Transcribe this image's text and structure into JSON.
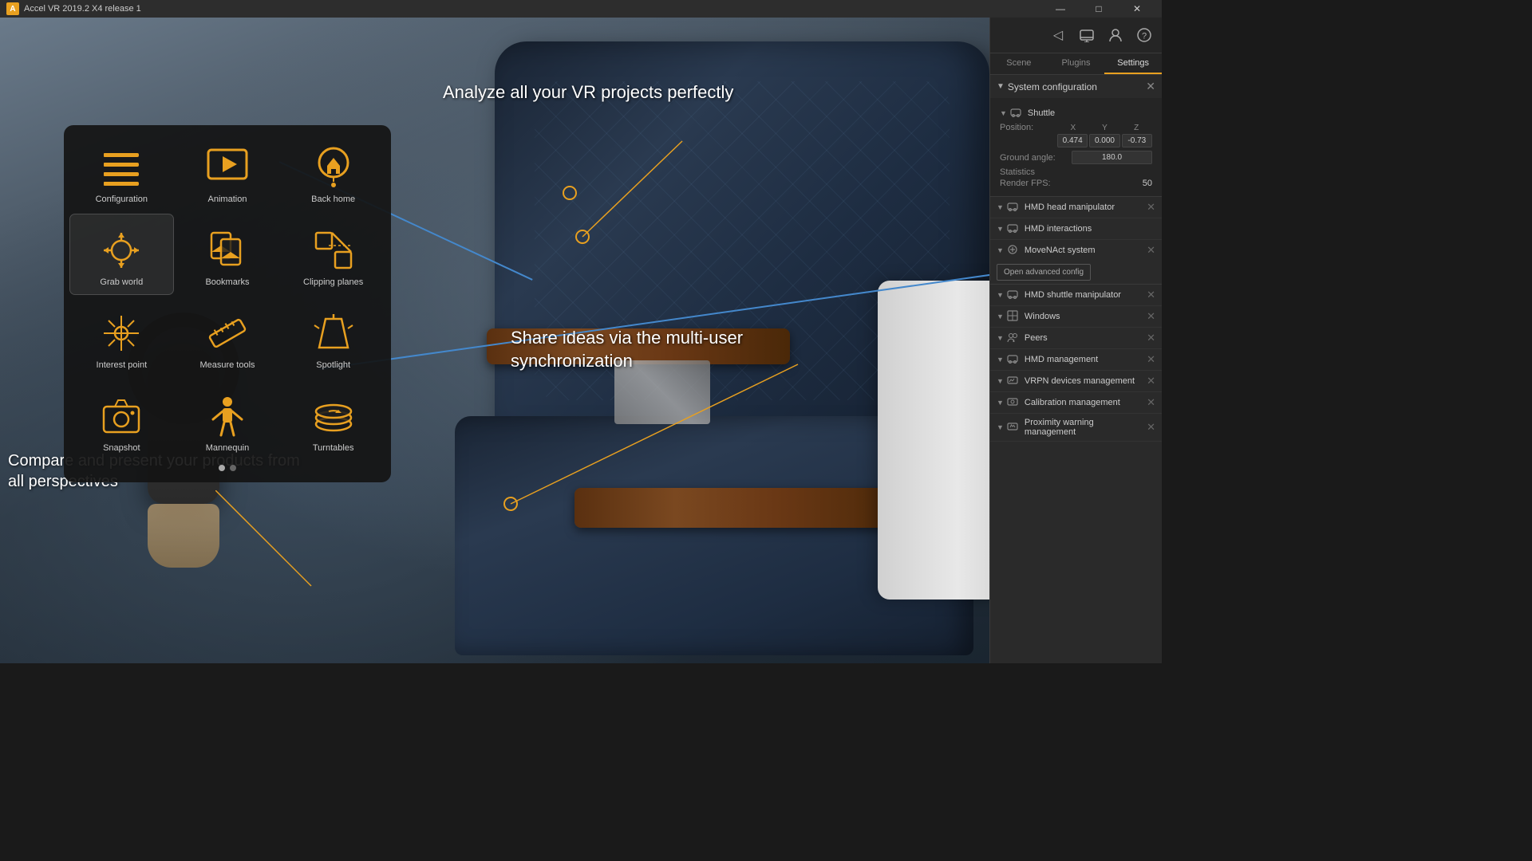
{
  "titlebar": {
    "title": "Accel VR 2019.2 X4 release 1",
    "icon": "A",
    "controls": {
      "minimize": "—",
      "maximize": "□",
      "close": "✕"
    }
  },
  "toolbar": {
    "icons": [
      "rss",
      "monitor",
      "user",
      "help"
    ]
  },
  "vr_menu": {
    "items": [
      {
        "id": "configuration",
        "label": "Configuration",
        "icon": "list"
      },
      {
        "id": "animation",
        "label": "Animation",
        "icon": "film"
      },
      {
        "id": "back_home",
        "label": "Back home",
        "icon": "home"
      },
      {
        "id": "grab_world",
        "label": "Grab world",
        "icon": "arrows"
      },
      {
        "id": "bookmarks",
        "label": "Bookmarks",
        "icon": "bookmark"
      },
      {
        "id": "clipping_planes",
        "label": "Clipping planes",
        "icon": "scissors"
      },
      {
        "id": "interest_point",
        "label": "Interest point",
        "icon": "star"
      },
      {
        "id": "measure_tools",
        "label": "Measure tools",
        "icon": "ruler"
      },
      {
        "id": "spotlight",
        "label": "Spotlight",
        "icon": "flashlight"
      },
      {
        "id": "snapshot",
        "label": "Snapshot",
        "icon": "camera"
      },
      {
        "id": "mannequin",
        "label": "Mannequin",
        "icon": "person"
      },
      {
        "id": "turntables",
        "label": "Turntables",
        "icon": "rotate"
      }
    ],
    "dots": [
      true,
      false
    ]
  },
  "annotations": {
    "top": "Analyze all your VR projects perfectly",
    "middle": "Share ideas via the multi-user synchronization",
    "bottom": "Compare and present your products from all perspectives"
  },
  "right_panel": {
    "top_icons": [
      "rss-icon",
      "monitor-icon",
      "user-icon",
      "help-icon"
    ],
    "tabs": [
      "Scene",
      "Plugins",
      "Settings"
    ],
    "active_tab": "Settings",
    "system_config": {
      "title": "System configuration",
      "shuttle": {
        "label": "Shuttle"
      },
      "position": {
        "label": "Position:",
        "x": "0.474",
        "y": "0.000",
        "z": "-0.73"
      },
      "ground_angle": {
        "label": "Ground angle:",
        "value": "180.0"
      },
      "statistics": {
        "label": "Statistics",
        "render_fps_label": "Render FPS:",
        "render_fps_value": "50"
      }
    },
    "list_items": [
      {
        "id": "hmd_head",
        "label": "HMD head manipulator",
        "has_close": true
      },
      {
        "id": "hmd_interactions",
        "label": "HMD interactions",
        "has_close": false
      },
      {
        "id": "moveNact",
        "label": "MoveNAct system",
        "has_close": true,
        "has_advanced": true,
        "advanced_label": "Open advanced config"
      },
      {
        "id": "hmd_shuttle",
        "label": "HMD shuttle manipulator",
        "has_close": true
      },
      {
        "id": "windows",
        "label": "Windows",
        "has_close": true
      },
      {
        "id": "peers",
        "label": "Peers",
        "has_close": true
      },
      {
        "id": "hmd_management",
        "label": "HMD management",
        "has_close": true
      },
      {
        "id": "vrpn_devices",
        "label": "VRPN devices management",
        "has_close": true
      },
      {
        "id": "calibration",
        "label": "Calibration management",
        "has_close": true
      },
      {
        "id": "proximity",
        "label": "Proximity warning management",
        "has_close": true
      }
    ]
  }
}
